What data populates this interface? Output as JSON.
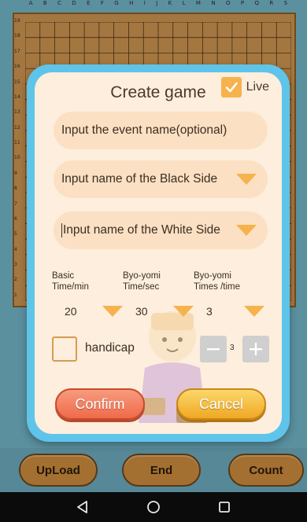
{
  "board": {
    "columns": [
      "A",
      "B",
      "C",
      "D",
      "E",
      "F",
      "G",
      "H",
      "I",
      "J",
      "K",
      "L",
      "M",
      "N",
      "O",
      "P",
      "Q",
      "R",
      "S"
    ],
    "rows": [
      "19",
      "18",
      "17",
      "16",
      "15",
      "14",
      "13",
      "12",
      "11",
      "10",
      "9",
      "8",
      "7",
      "6",
      "5",
      "4",
      "3",
      "2",
      "1"
    ]
  },
  "dialog": {
    "title": "Create game",
    "live_label": "Live",
    "live_checked": true,
    "event_name_placeholder": "Input the event name(optional)",
    "black_side_placeholder": "Input name of the Black Side",
    "white_side_placeholder": "Input name of the White Side",
    "basic_time_label_1": "Basic",
    "basic_time_label_2": "Time/min",
    "basic_time_value": "20",
    "byoyomi_time_label_1": "Byo-yomi",
    "byoyomi_time_label_2": "Time/sec",
    "byoyomi_time_value": "30",
    "byoyomi_times_label_1": "Byo-yomi",
    "byoyomi_times_label_2": "Times /time",
    "byoyomi_times_value": "3",
    "handicap_label": "handicap",
    "handicap_checked": false,
    "handicap_value": "3",
    "confirm_label": "Confirm",
    "cancel_label": "Cancel"
  },
  "action_bar": {
    "upload_label": "UpLoad",
    "end_label": "End",
    "count_label": "Count"
  },
  "colors": {
    "accent_orange": "#f6b24c",
    "dialog_frame": "#5ec4ea",
    "dialog_bg": "#fdeedd",
    "confirm": "#ef6a4a",
    "cancel": "#f0a824",
    "board": "#c8924f"
  }
}
